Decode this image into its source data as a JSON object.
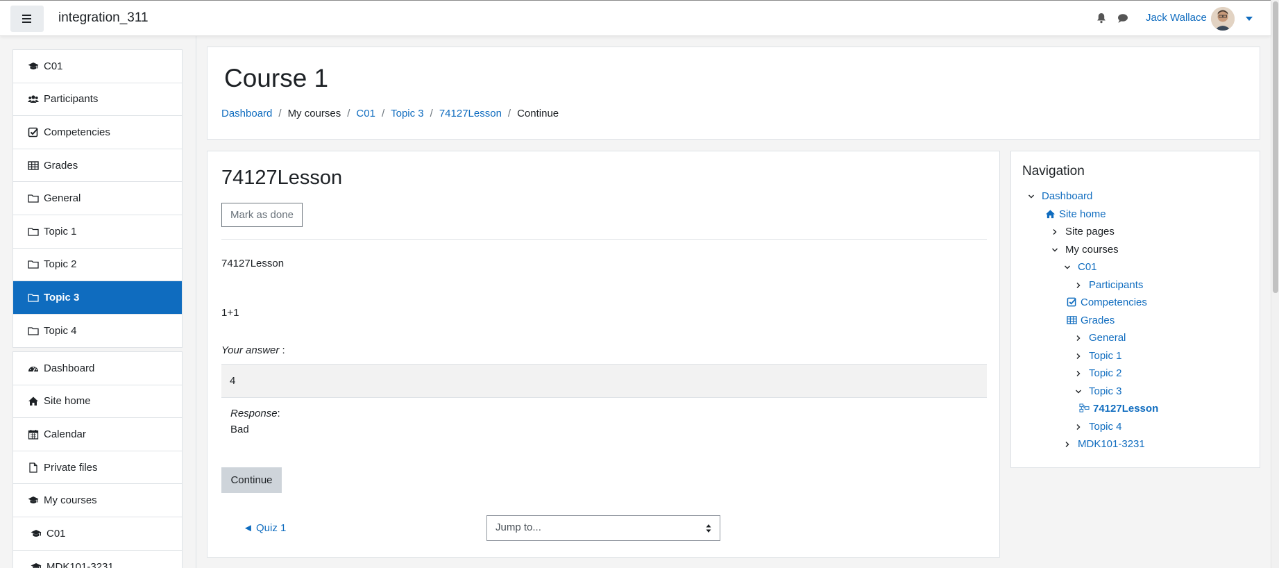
{
  "navbar": {
    "site_name": "integration_311",
    "user_name": "Jack Wallace",
    "icons": [
      "menu-icon",
      "bell-icon",
      "chat-icon",
      "avatar",
      "caret-down-icon"
    ]
  },
  "drawer": {
    "course_items": [
      {
        "label": "C01",
        "icon": "graduation-cap-icon"
      },
      {
        "label": "Participants",
        "icon": "users-icon"
      },
      {
        "label": "Competencies",
        "icon": "check-square-icon"
      },
      {
        "label": "Grades",
        "icon": "table-icon"
      },
      {
        "label": "General",
        "icon": "folder-icon"
      },
      {
        "label": "Topic 1",
        "icon": "folder-icon"
      },
      {
        "label": "Topic 2",
        "icon": "folder-icon"
      },
      {
        "label": "Topic 3",
        "icon": "folder-icon",
        "active": true
      },
      {
        "label": "Topic 4",
        "icon": "folder-icon"
      }
    ],
    "site_items": [
      {
        "label": "Dashboard",
        "icon": "dashboard-icon"
      },
      {
        "label": "Site home",
        "icon": "home-icon"
      },
      {
        "label": "Calendar",
        "icon": "calendar-icon"
      },
      {
        "label": "Private files",
        "icon": "file-icon"
      },
      {
        "label": "My courses",
        "icon": "graduation-cap-icon"
      },
      {
        "label": "C01",
        "icon": "graduation-cap-icon"
      },
      {
        "label": "MDK101-3231",
        "icon": "graduation-cap-icon"
      }
    ]
  },
  "header": {
    "course_title": "Course 1",
    "breadcrumb": [
      {
        "label": "Dashboard",
        "link": true
      },
      {
        "label": "My courses",
        "link": false
      },
      {
        "label": "C01",
        "link": true
      },
      {
        "label": "Topic 3",
        "link": true
      },
      {
        "label": "74127Lesson",
        "link": true
      },
      {
        "label": "Continue",
        "link": false
      }
    ]
  },
  "lesson": {
    "title": "74127Lesson",
    "mark_done_label": "Mark as done",
    "content_text": "74127Lesson",
    "question": "1+1",
    "your_answer_label": "Your answer",
    "your_answer_colon": " :",
    "answer_value": "4",
    "response_label": "Response",
    "response_colon": ":",
    "response_value": "Bad",
    "continue_label": "Continue",
    "prev_link": "◄ Quiz 1",
    "jump_placeholder": "Jump to..."
  },
  "nav_block": {
    "title": "Navigation",
    "nodes": {
      "dashboard": "Dashboard",
      "site_home": "Site home",
      "site_pages": "Site pages",
      "my_courses": "My courses",
      "c01": "C01",
      "participants": "Participants",
      "competencies": "Competencies",
      "grades": "Grades",
      "general": "General",
      "topic1": "Topic 1",
      "topic2": "Topic 2",
      "topic3": "Topic 3",
      "lesson": "74127Lesson",
      "topic4": "Topic 4",
      "mdk": "MDK101-3231"
    }
  },
  "colors": {
    "accent": "#0f6cbf",
    "page_bg": "#f4f4f4",
    "active_item_text": "#ffffff"
  }
}
